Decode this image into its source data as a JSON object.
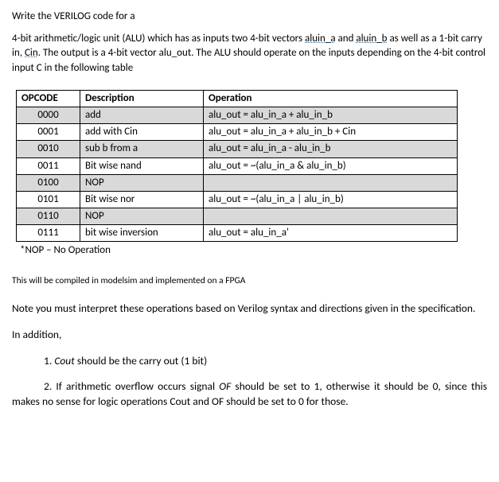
{
  "heading": "Write the VERILOG code for a",
  "intro": {
    "part1": "4-bit arithmetic/logic unit (ALU) which has as inputs two 4-bit vectors ",
    "link1": "aluin_a",
    "part2": " and ",
    "link2": "aluin_b",
    "part3": " as well as a 1-bit carry in, ",
    "link3": "Cin",
    "part4": ". The output is a 4-bit vector alu_out. The ALU should operate on the inputs depending on the 4-bit control input C in the following table"
  },
  "table": {
    "headers": {
      "opcode": "OPCODE",
      "desc": "Description",
      "op": "Operation"
    },
    "rows": [
      {
        "opcode": "0000",
        "desc": "add",
        "op": "alu_out = alu_in_a + alu_in_b",
        "shaded": true
      },
      {
        "opcode": "0001",
        "desc": "add with Cin",
        "op": "alu_out = alu_in_a + alu_in_b + Cin",
        "shaded": false
      },
      {
        "opcode": "0010",
        "desc": "sub b from a",
        "op": "alu_out = alu_in_a - alu_in_b",
        "shaded": true
      },
      {
        "opcode": "0011",
        "desc": "Bit wise nand",
        "op": "alu_out = ~(alu_in_a &  alu_in_b)",
        "shaded": false
      },
      {
        "opcode": "0100",
        "desc": "NOP",
        "op": "",
        "shaded": true
      },
      {
        "opcode": "0101",
        "desc": "Bit wise nor",
        "op": "alu_out = ~(alu_in_a | alu_in_b)",
        "shaded": false
      },
      {
        "opcode": "0110",
        "desc": "NOP",
        "op": "",
        "shaded": true
      },
      {
        "opcode": "0111",
        "desc": "bit wise inversion",
        "op": "alu_out = alu_in_a'",
        "shaded": false
      }
    ]
  },
  "nop_note": "*NOP – No Operation",
  "compile_note": "This will be compiled in modelsim and implemented on a FPGA",
  "note_block": "Note you must interpret these operations based on Verilog syntax and directions given in the specification.",
  "in_addition": "In addition,",
  "list": {
    "item1_num": "1. ",
    "item1_italic": "Cout",
    "item1_rest": " should be the carry out (1 bit)",
    "item2_num": "2. ",
    "item2_part1": "If arithmetic overflow occurs signal ",
    "item2_italic": "OF",
    "item2_part2": " should be set to 1, otherwise it should be 0, since this makes no sense for logic operations Cout and OF should be set to 0 for those."
  }
}
